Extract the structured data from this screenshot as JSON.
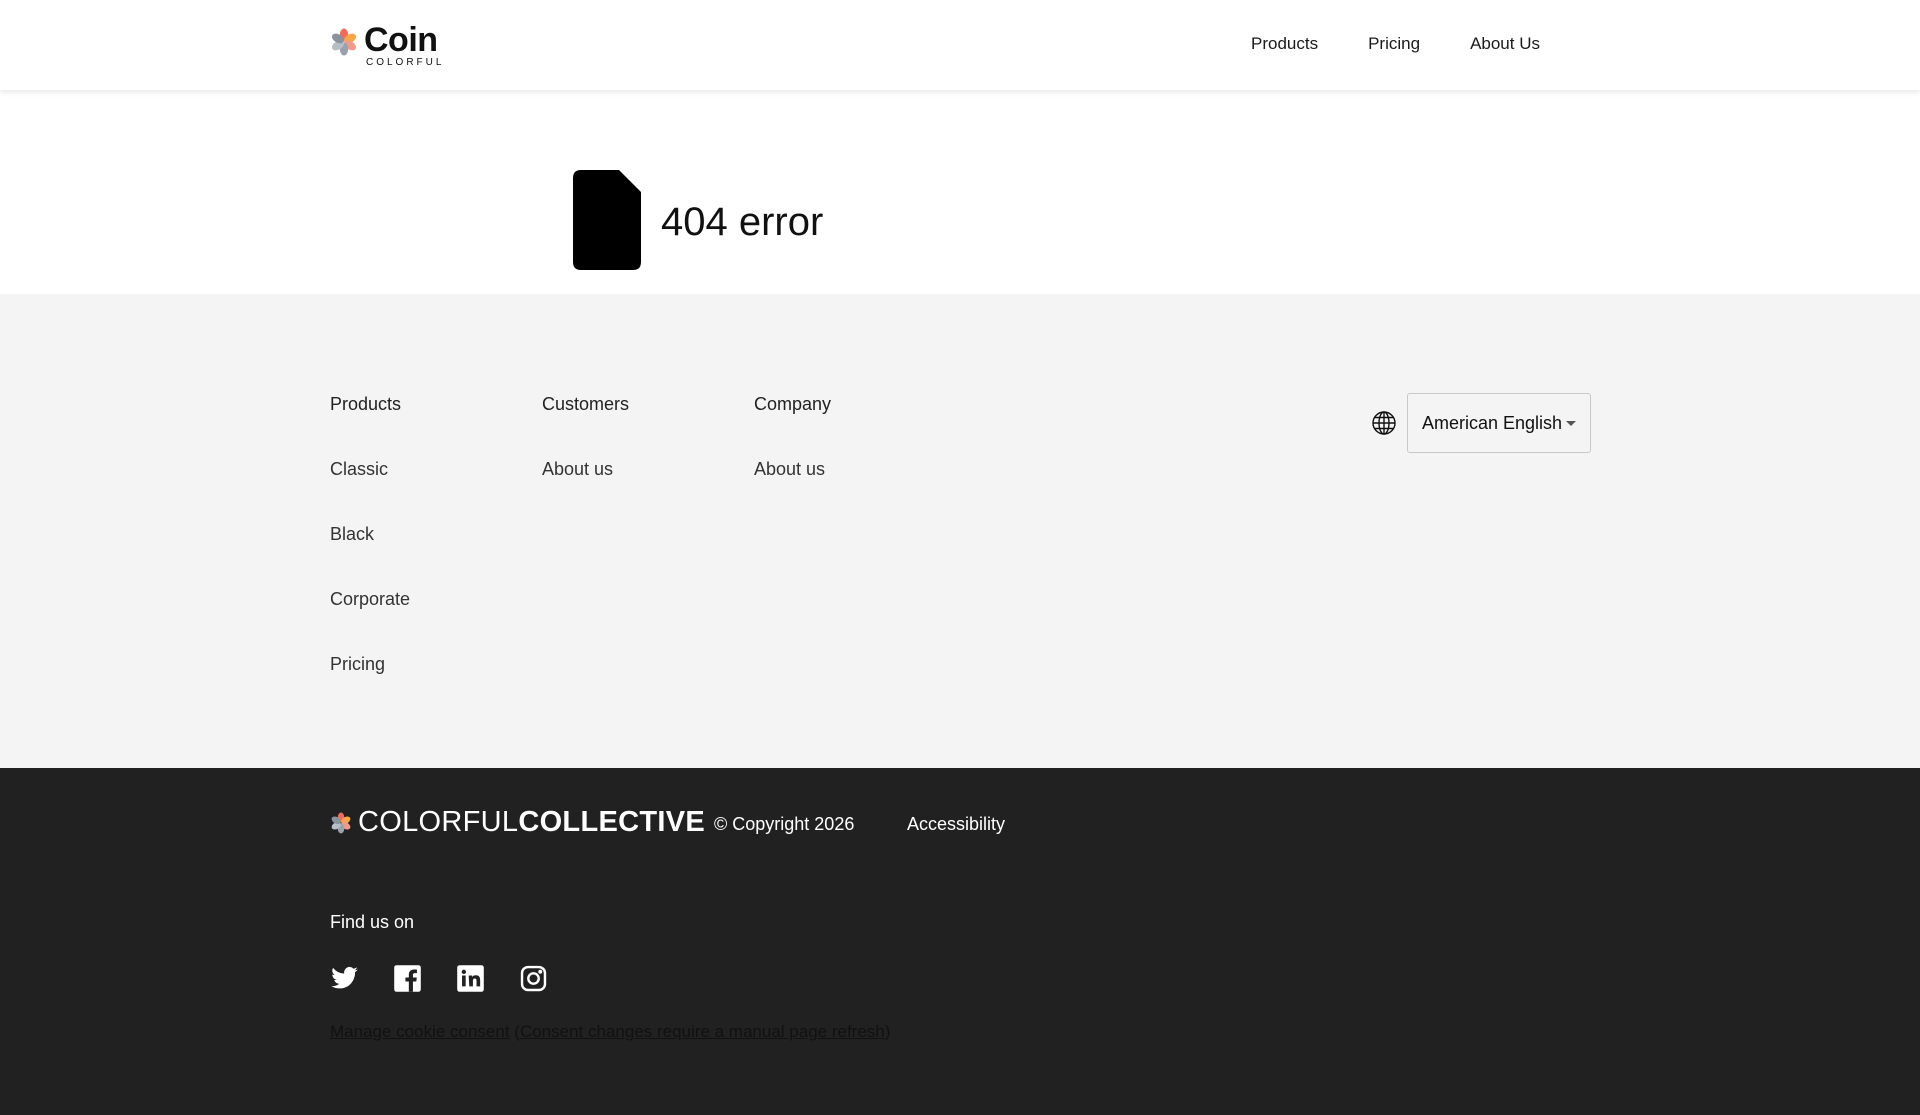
{
  "header": {
    "logo": {
      "name": "Coin",
      "tagline": "COLORFUL"
    },
    "nav": [
      "Products",
      "Pricing",
      "About Us"
    ]
  },
  "main": {
    "title": "404 error",
    "icon": "file-icon"
  },
  "footer": {
    "columns": [
      {
        "title": "Products",
        "links": [
          "Classic",
          "Black",
          "Corporate",
          "Pricing"
        ]
      },
      {
        "title": "Customers",
        "links": [
          "About us"
        ]
      },
      {
        "title": "Company",
        "links": [
          "About us"
        ]
      }
    ],
    "language": {
      "icon": "globe-icon",
      "selected": "American English"
    }
  },
  "bottom": {
    "brand_light": "COLORFUL",
    "brand_bold": "COLLECTIVE",
    "copyright": "© Copyright 2026",
    "accessibility": "Accessibility",
    "find_us": "Find us on",
    "socials": [
      "twitter-icon",
      "facebook-icon",
      "linkedin-icon",
      "instagram-icon"
    ],
    "cookie_link": "Manage cookie consent",
    "cookie_open": " (",
    "cookie_note": "Consent changes require a manual page refresh",
    "cookie_close": ")"
  },
  "colors": {
    "footer_bg": "#f4f4f4",
    "bottom_bg": "#212121",
    "logo_red": "#f26a5b",
    "logo_orange": "#f7a64a",
    "logo_gray": "#9aa3ad"
  }
}
